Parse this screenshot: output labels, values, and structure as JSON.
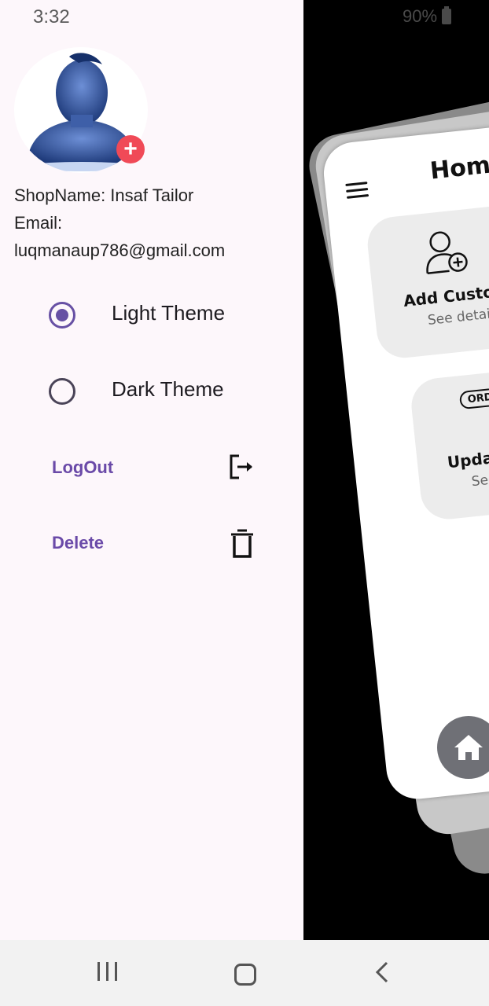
{
  "status_bar": {
    "time": "3:32",
    "battery": "90%"
  },
  "drawer": {
    "shop_name": "ShopName: Insaf Tailor",
    "email_label": "Email:",
    "email": "luqmanaup786@gmail.com",
    "themes": [
      {
        "label": "Light Theme",
        "selected": true
      },
      {
        "label": "Dark Theme",
        "selected": false
      }
    ],
    "actions": {
      "logout_label": "LogOut",
      "delete_label": "Delete"
    },
    "accent_color": "#6a4aa8"
  },
  "app_preview": {
    "title": "Home",
    "tiles": [
      {
        "title": "Add Customer",
        "subtitle": "See details"
      },
      {
        "title": "Update Ord",
        "subtitle": "See deta",
        "badge": "ORDER"
      }
    ]
  },
  "icons": [
    "avatar-add-icon",
    "logout-icon",
    "trash-icon",
    "hamburger-icon",
    "home-icon",
    "add-user-icon",
    "cursor-icon",
    "battery-icon"
  ]
}
